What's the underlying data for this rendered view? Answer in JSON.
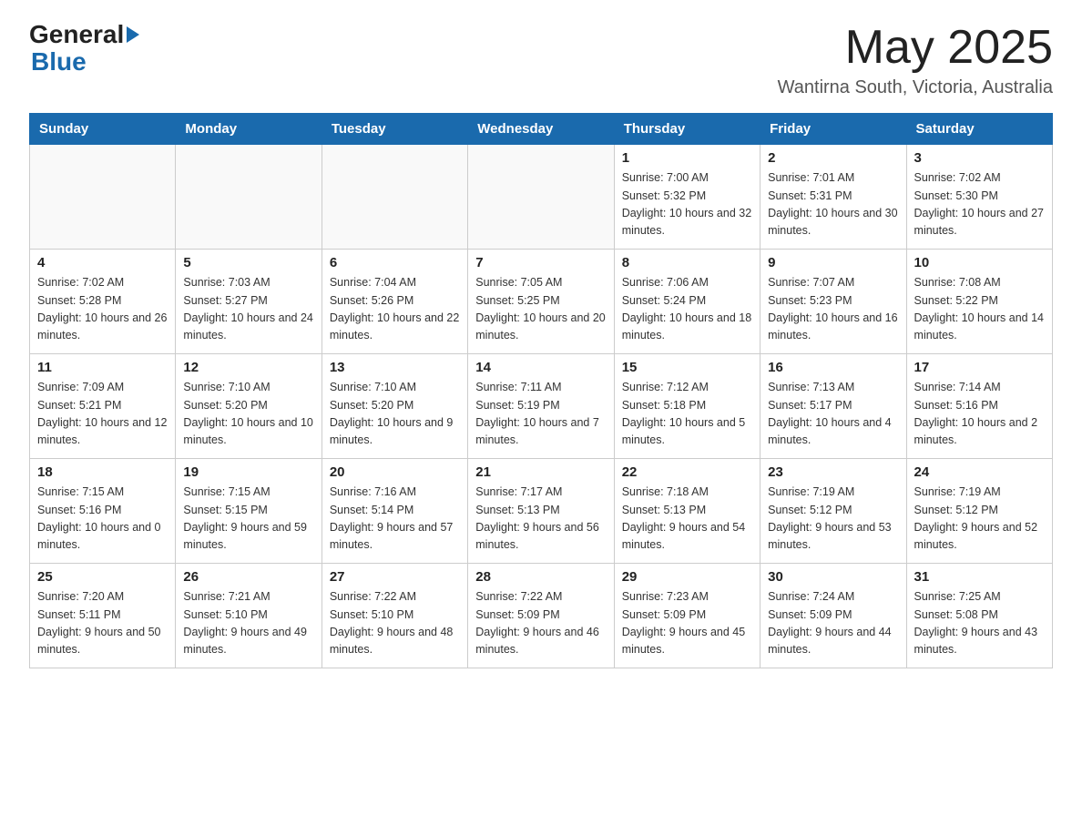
{
  "header": {
    "logo_general": "General",
    "logo_blue": "Blue",
    "month_title": "May 2025",
    "location": "Wantirna South, Victoria, Australia"
  },
  "weekdays": [
    "Sunday",
    "Monday",
    "Tuesday",
    "Wednesday",
    "Thursday",
    "Friday",
    "Saturday"
  ],
  "weeks": [
    [
      {
        "day": "",
        "sunrise": "",
        "sunset": "",
        "daylight": ""
      },
      {
        "day": "",
        "sunrise": "",
        "sunset": "",
        "daylight": ""
      },
      {
        "day": "",
        "sunrise": "",
        "sunset": "",
        "daylight": ""
      },
      {
        "day": "",
        "sunrise": "",
        "sunset": "",
        "daylight": ""
      },
      {
        "day": "1",
        "sunrise": "Sunrise: 7:00 AM",
        "sunset": "Sunset: 5:32 PM",
        "daylight": "Daylight: 10 hours and 32 minutes."
      },
      {
        "day": "2",
        "sunrise": "Sunrise: 7:01 AM",
        "sunset": "Sunset: 5:31 PM",
        "daylight": "Daylight: 10 hours and 30 minutes."
      },
      {
        "day": "3",
        "sunrise": "Sunrise: 7:02 AM",
        "sunset": "Sunset: 5:30 PM",
        "daylight": "Daylight: 10 hours and 27 minutes."
      }
    ],
    [
      {
        "day": "4",
        "sunrise": "Sunrise: 7:02 AM",
        "sunset": "Sunset: 5:28 PM",
        "daylight": "Daylight: 10 hours and 26 minutes."
      },
      {
        "day": "5",
        "sunrise": "Sunrise: 7:03 AM",
        "sunset": "Sunset: 5:27 PM",
        "daylight": "Daylight: 10 hours and 24 minutes."
      },
      {
        "day": "6",
        "sunrise": "Sunrise: 7:04 AM",
        "sunset": "Sunset: 5:26 PM",
        "daylight": "Daylight: 10 hours and 22 minutes."
      },
      {
        "day": "7",
        "sunrise": "Sunrise: 7:05 AM",
        "sunset": "Sunset: 5:25 PM",
        "daylight": "Daylight: 10 hours and 20 minutes."
      },
      {
        "day": "8",
        "sunrise": "Sunrise: 7:06 AM",
        "sunset": "Sunset: 5:24 PM",
        "daylight": "Daylight: 10 hours and 18 minutes."
      },
      {
        "day": "9",
        "sunrise": "Sunrise: 7:07 AM",
        "sunset": "Sunset: 5:23 PM",
        "daylight": "Daylight: 10 hours and 16 minutes."
      },
      {
        "day": "10",
        "sunrise": "Sunrise: 7:08 AM",
        "sunset": "Sunset: 5:22 PM",
        "daylight": "Daylight: 10 hours and 14 minutes."
      }
    ],
    [
      {
        "day": "11",
        "sunrise": "Sunrise: 7:09 AM",
        "sunset": "Sunset: 5:21 PM",
        "daylight": "Daylight: 10 hours and 12 minutes."
      },
      {
        "day": "12",
        "sunrise": "Sunrise: 7:10 AM",
        "sunset": "Sunset: 5:20 PM",
        "daylight": "Daylight: 10 hours and 10 minutes."
      },
      {
        "day": "13",
        "sunrise": "Sunrise: 7:10 AM",
        "sunset": "Sunset: 5:20 PM",
        "daylight": "Daylight: 10 hours and 9 minutes."
      },
      {
        "day": "14",
        "sunrise": "Sunrise: 7:11 AM",
        "sunset": "Sunset: 5:19 PM",
        "daylight": "Daylight: 10 hours and 7 minutes."
      },
      {
        "day": "15",
        "sunrise": "Sunrise: 7:12 AM",
        "sunset": "Sunset: 5:18 PM",
        "daylight": "Daylight: 10 hours and 5 minutes."
      },
      {
        "day": "16",
        "sunrise": "Sunrise: 7:13 AM",
        "sunset": "Sunset: 5:17 PM",
        "daylight": "Daylight: 10 hours and 4 minutes."
      },
      {
        "day": "17",
        "sunrise": "Sunrise: 7:14 AM",
        "sunset": "Sunset: 5:16 PM",
        "daylight": "Daylight: 10 hours and 2 minutes."
      }
    ],
    [
      {
        "day": "18",
        "sunrise": "Sunrise: 7:15 AM",
        "sunset": "Sunset: 5:16 PM",
        "daylight": "Daylight: 10 hours and 0 minutes."
      },
      {
        "day": "19",
        "sunrise": "Sunrise: 7:15 AM",
        "sunset": "Sunset: 5:15 PM",
        "daylight": "Daylight: 9 hours and 59 minutes."
      },
      {
        "day": "20",
        "sunrise": "Sunrise: 7:16 AM",
        "sunset": "Sunset: 5:14 PM",
        "daylight": "Daylight: 9 hours and 57 minutes."
      },
      {
        "day": "21",
        "sunrise": "Sunrise: 7:17 AM",
        "sunset": "Sunset: 5:13 PM",
        "daylight": "Daylight: 9 hours and 56 minutes."
      },
      {
        "day": "22",
        "sunrise": "Sunrise: 7:18 AM",
        "sunset": "Sunset: 5:13 PM",
        "daylight": "Daylight: 9 hours and 54 minutes."
      },
      {
        "day": "23",
        "sunrise": "Sunrise: 7:19 AM",
        "sunset": "Sunset: 5:12 PM",
        "daylight": "Daylight: 9 hours and 53 minutes."
      },
      {
        "day": "24",
        "sunrise": "Sunrise: 7:19 AM",
        "sunset": "Sunset: 5:12 PM",
        "daylight": "Daylight: 9 hours and 52 minutes."
      }
    ],
    [
      {
        "day": "25",
        "sunrise": "Sunrise: 7:20 AM",
        "sunset": "Sunset: 5:11 PM",
        "daylight": "Daylight: 9 hours and 50 minutes."
      },
      {
        "day": "26",
        "sunrise": "Sunrise: 7:21 AM",
        "sunset": "Sunset: 5:10 PM",
        "daylight": "Daylight: 9 hours and 49 minutes."
      },
      {
        "day": "27",
        "sunrise": "Sunrise: 7:22 AM",
        "sunset": "Sunset: 5:10 PM",
        "daylight": "Daylight: 9 hours and 48 minutes."
      },
      {
        "day": "28",
        "sunrise": "Sunrise: 7:22 AM",
        "sunset": "Sunset: 5:09 PM",
        "daylight": "Daylight: 9 hours and 46 minutes."
      },
      {
        "day": "29",
        "sunrise": "Sunrise: 7:23 AM",
        "sunset": "Sunset: 5:09 PM",
        "daylight": "Daylight: 9 hours and 45 minutes."
      },
      {
        "day": "30",
        "sunrise": "Sunrise: 7:24 AM",
        "sunset": "Sunset: 5:09 PM",
        "daylight": "Daylight: 9 hours and 44 minutes."
      },
      {
        "day": "31",
        "sunrise": "Sunrise: 7:25 AM",
        "sunset": "Sunset: 5:08 PM",
        "daylight": "Daylight: 9 hours and 43 minutes."
      }
    ]
  ]
}
